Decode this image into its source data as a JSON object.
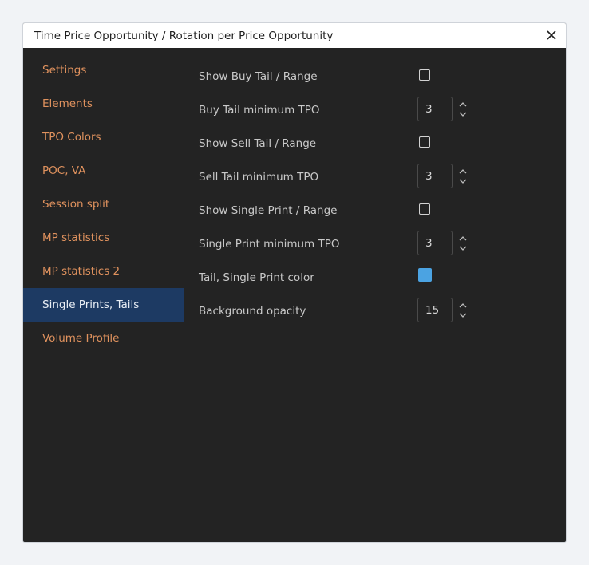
{
  "dialog": {
    "title": "Time Price Opportunity / Rotation per Price Opportunity",
    "close_icon": "close-icon"
  },
  "sidebar": {
    "items": [
      {
        "label": "Settings"
      },
      {
        "label": "Elements"
      },
      {
        "label": "TPO Colors"
      },
      {
        "label": "POC, VA"
      },
      {
        "label": "Session split"
      },
      {
        "label": "MP statistics"
      },
      {
        "label": "MP statistics 2"
      },
      {
        "label": "Single Prints, Tails",
        "active": true
      },
      {
        "label": "Volume Profile"
      }
    ],
    "link_color": "#e0925e",
    "active_bg": "#1d3a63"
  },
  "settings": {
    "show_buy_tail": {
      "label": "Show Buy Tail / Range",
      "checked": false
    },
    "buy_tail_min": {
      "label": "Buy Tail minimum TPO",
      "value": "3"
    },
    "show_sell_tail": {
      "label": "Show Sell Tail / Range",
      "checked": false
    },
    "sell_tail_min": {
      "label": "Sell Tail minimum TPO",
      "value": "3"
    },
    "show_single_print": {
      "label": "Show Single Print / Range",
      "checked": false
    },
    "single_print_min": {
      "label": "Single Print minimum TPO",
      "value": "3"
    },
    "tail_color": {
      "label": "Tail, Single Print color",
      "color": "#4ba3e2"
    },
    "bg_opacity": {
      "label": "Background opacity",
      "value": "15"
    }
  }
}
